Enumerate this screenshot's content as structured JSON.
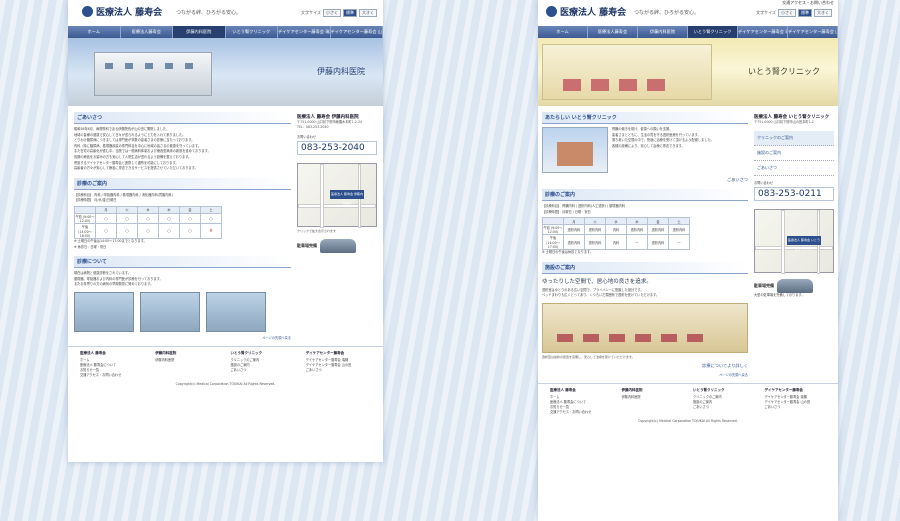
{
  "page1": {
    "logo": {
      "small": "Medical Corporation TOJUKAI",
      "name": "医療法人 藤寿会"
    },
    "tagline": "つながる絆、ひろがる安心。",
    "fontsize": {
      "label": "文字サイズ",
      "small": "小さく",
      "normal": "標準",
      "large": "大きく"
    },
    "nav": [
      "ホーム",
      "医療法人藤寿会",
      "伊藤内科医院",
      "いとう腎クリニック",
      "デイケアセンター藤寿会 瑞穂",
      "デイケアセンター藤寿会 山の田"
    ],
    "hero_title": "伊藤内科医院",
    "greet_title": "ごあいさつ",
    "greet_text": [
      "昭和58年6月、病理専科である伊藤院長が山の田に開院しました。",
      "地域の皆様の健康で安心して日々が送られるようにと力を入れて参りました。",
      "とりわけ糖尿病につきましては専門医が多数の患者さまの診療に当たっております。",
      "内科（特に糖尿病、循環器疾患の専門科目を中心に地域の皆さまの健康を守っています。",
      "また在宅の高齢化が進む中、当院では一般病科体制および療養型病床の新設を進めております。",
      "長期の療養をお望みの方も安心して入院生活が送れるよう設備を整えております。",
      "併設するデイケアセンター藤寿会と連携して通所を可能にしております。",
      "高齢者の方々が安心して療養に専念できるサービスを提供させていただいております。"
    ],
    "info_title": "診療のご案内",
    "info_line1": "【診療科目】 内科 / 呼吸器内科 / 循環器内科 / 消化器内科(胃腸内科)",
    "info_line2": "【診療時間】 月/水/金/日曜日",
    "table_note": "○ 午前の診療は〜",
    "table_head": [
      "",
      "月",
      "火",
      "水",
      "木",
      "金",
      "土"
    ],
    "table_rows": [
      [
        "午前\n(9:00〜12:00)",
        "○",
        "○",
        "○",
        "○",
        "○",
        "○"
      ],
      [
        "午後\n(14:00〜18:00)",
        "○",
        "○",
        "○",
        "○",
        "○",
        "※"
      ]
    ],
    "table_foot": [
      "※ 土曜日の午後は14:00〜17:00までとなります。",
      "※ 休診日：日曜・祝日"
    ],
    "about_title": "診療について",
    "about_text": [
      "現在は病院と健康診断をされています。",
      "循環器、呼吸器および内科の専門医が診療を行っております。",
      "またお年寄りの方の病気の早期発見に努めております。"
    ],
    "more": "ページの先頭へ戻る",
    "side_name_label": "医療法人 藤寿会",
    "side_name": "伊藤内科医院",
    "addr": [
      "〒751-0000 山口県下関市綾羅木本町1-2-34",
      "TEL：083-253-2040"
    ],
    "tel_label": "お問い合わせ",
    "tel": "083-253-2040",
    "map_pin": "医療法人 藤寿会 伊藤内科医院",
    "map_link": "クリックで拡大表示されます",
    "parking": "駐車場完備",
    "footer": [
      {
        "head": "医療法人 藤寿会",
        "items": [
          "ホーム",
          "医療法人 藤寿会について",
          "お知らせ一覧",
          "交通アクセス・お問い合わせ"
        ]
      },
      {
        "head": "伊藤内科医院",
        "items": [
          "伊藤内科医院"
        ]
      },
      {
        "head": "いとう腎クリニック",
        "items": [
          "クリニックのご案内",
          "施設のご案内",
          "ごあいさつ"
        ]
      },
      {
        "head": "デイケアセンター藤寿会",
        "items": [
          "デイケアセンター藤寿会 瑞穂",
          "デイケアセンター藤寿会 山の田",
          "ごあいさつ"
        ]
      }
    ],
    "copy": "Copyright(c) Medical Corporation TOJUKAI All Rights Reserved."
  },
  "page2": {
    "toplink": "交通アクセス・お問い合わせ",
    "hero_title": "いとう腎クリニック",
    "new_title": "あたらしい いとう腎クリニック",
    "intro_text": [
      "腎臓の働きを助け、健康への願いを支援。",
      "患者さまとともに、生活の質を守る透析医療を行っています。",
      "落ち着いた空間の中で、快適に治療を受けて頂けるよう配慮しました。",
      "各種の設備により、安心して治療に専念できます。"
    ],
    "greet_link": "ごあいさつ",
    "info_title": "診療のご案内",
    "info_line1": "【診療科目】 腎臓内科 / 透析内科(人工透析) / 循環器内科",
    "info_line2": "【診療時間】 月曜日 / 日曜・祝日",
    "table_head": [
      "",
      "月",
      "火",
      "水",
      "木",
      "金",
      "土"
    ],
    "table_rows": [
      [
        "午前\n(9:00〜12:00)",
        "透析内科",
        "透析内科",
        "内科",
        "透析内科",
        "透析内科",
        "透析内科"
      ],
      [
        "午後\n(14:00〜17:00)",
        "透析内科",
        "透析内科",
        "内科",
        "―",
        "透析内科",
        "―"
      ]
    ],
    "table_foot": "※ 土曜日の午後は休診となります。",
    "facility_title": "施設のご案内",
    "catch": "ゆったりした空間で、居心地の良さを追求。",
    "facility_text": [
      "透析室はゆとりのある広い空間で、プライバシーに配慮した設計です。",
      "ベッドまわりも広くとってあり、くつろいだ雰囲気で透析を受けていただけます。"
    ],
    "caption": "透析室は最新の装置を完備し、安心して治療を受けていただけます。",
    "facility_link": "診療についてより詳しく",
    "more": "ページの先頭へ戻る",
    "side_name_label": "医療法人 藤寿会",
    "side_name": "いとう腎クリニック",
    "addr": "〒751-0000 山口県下関市山の田本町1-2",
    "side_menu": [
      "クリニックのご案内",
      "施設のご案内",
      "ごあいさつ"
    ],
    "tel_label": "お問い合わせ",
    "tel": "083-253-0211",
    "map_pin": "医療法人 藤寿会 いとう腎クリニック",
    "parking": "駐車場完備",
    "parking_text": "大型の駐車場を完備しております。",
    "copy": "Copyright(c) Medical Corporation TOJUKAI All Rights Reserved."
  }
}
